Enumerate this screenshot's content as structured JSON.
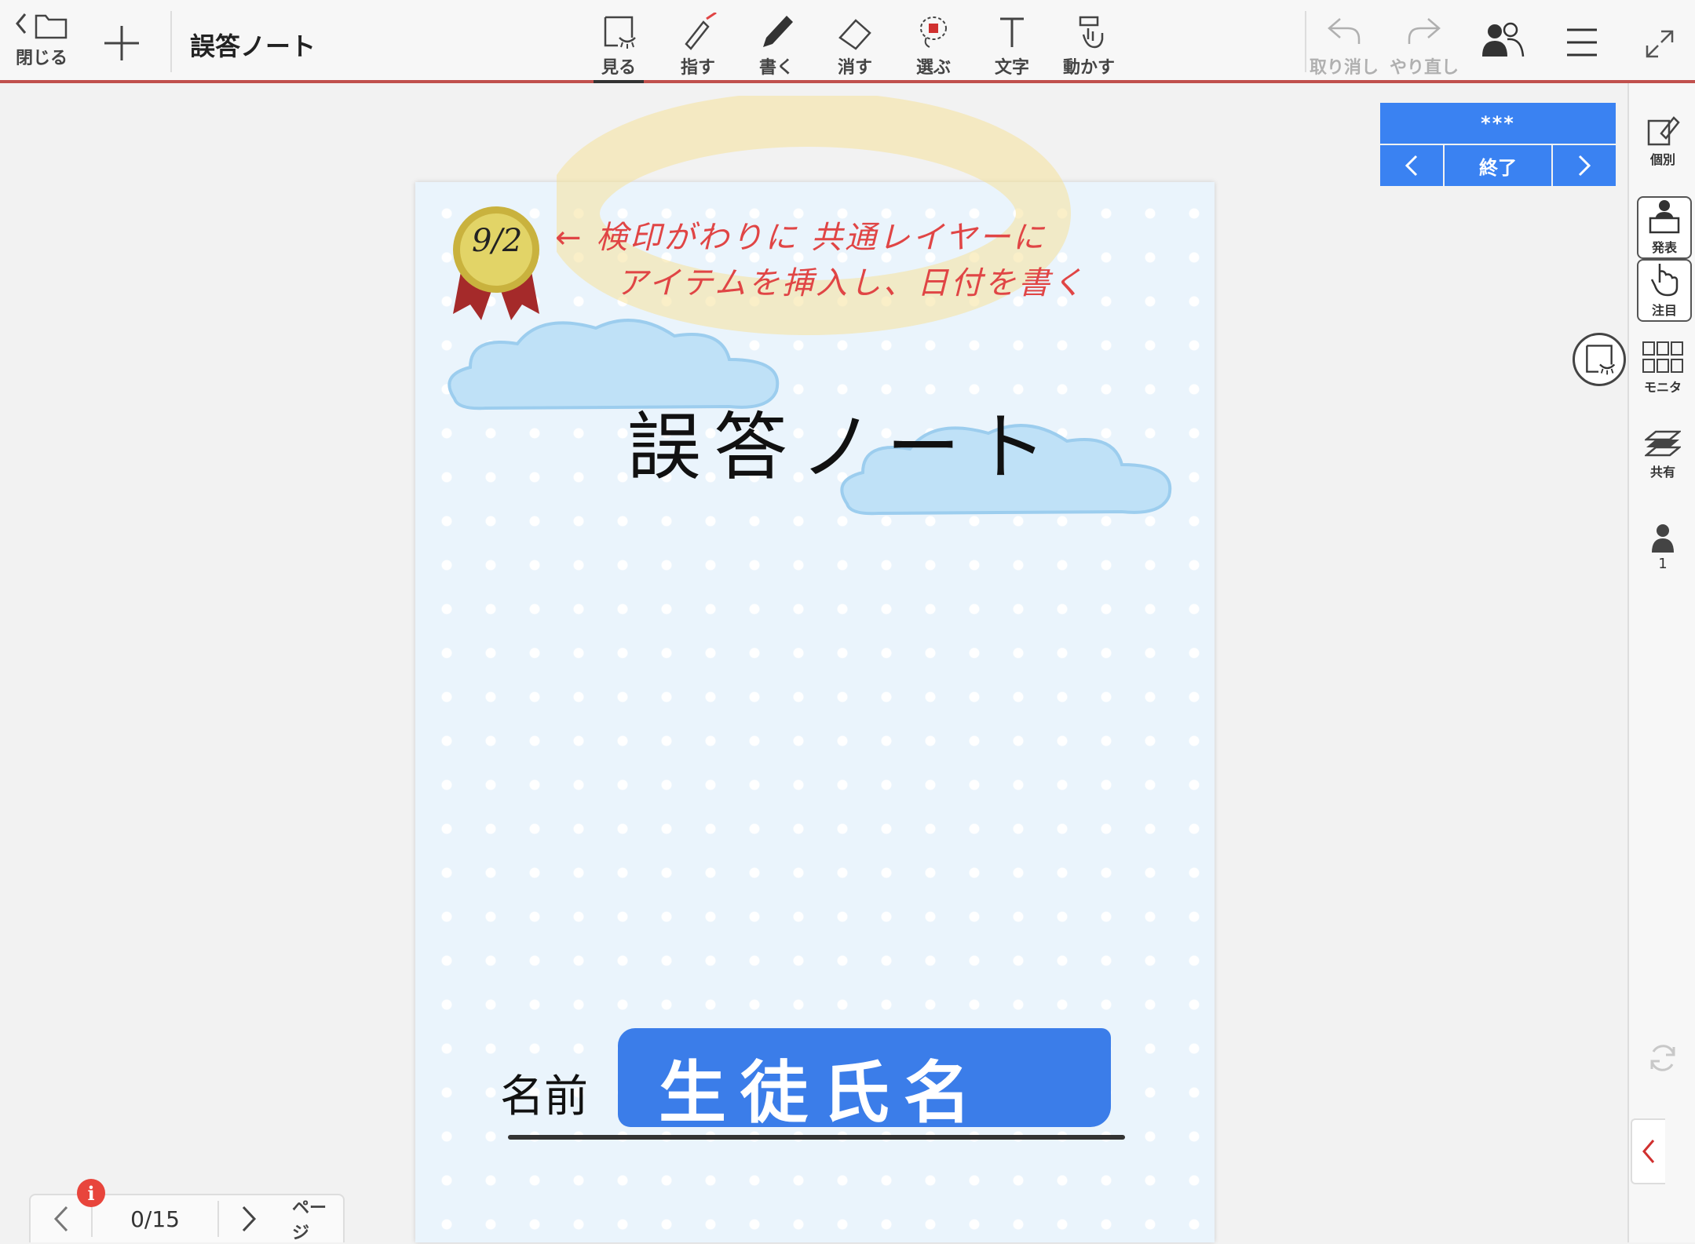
{
  "toolbar": {
    "close_label": "閉じる",
    "doc_title": "誤答ノート",
    "tools": {
      "view": "見る",
      "point": "指す",
      "write": "書く",
      "erase": "消す",
      "select": "選ぶ",
      "text": "文字",
      "move": "動かす"
    },
    "undo_label": "取り消し",
    "redo_label": "やり直し"
  },
  "presentation_nav": {
    "title": "***",
    "end_label": "終了"
  },
  "side_panel": {
    "individual": "個別",
    "present": "発表",
    "attention": "注目",
    "monitor": "モニタ",
    "share": "共有",
    "participants": "1"
  },
  "page": {
    "badge_date": "9/2",
    "annotation_line1": "← 検印がわりに 共通レイヤーに",
    "annotation_line2": "アイテムを挿入し、日付を書く",
    "title": "誤答ノート",
    "name_label": "名前",
    "name_value": "生徒氏名"
  },
  "pager": {
    "count": "0/15",
    "label": "ページ",
    "badge": "i"
  },
  "colors": {
    "accent": "#3a82f2",
    "toolbar_border": "#c0504d",
    "annotation": "#e04545"
  }
}
